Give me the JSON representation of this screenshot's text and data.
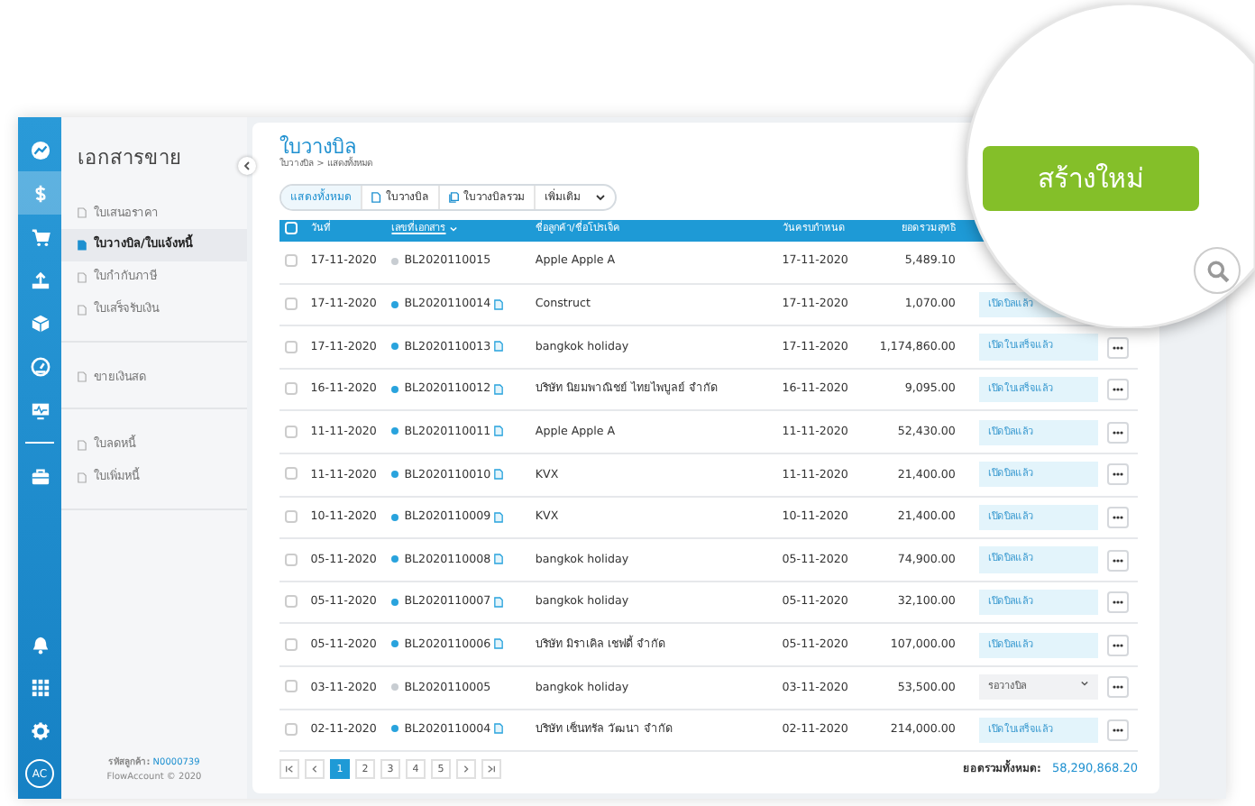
{
  "rail": {
    "top": [
      {
        "kind": "logo",
        "selected": false
      },
      {
        "kind": "dollar",
        "selected": true
      },
      {
        "kind": "cart",
        "selected": false
      },
      {
        "kind": "upload",
        "selected": false
      },
      {
        "kind": "box",
        "selected": false
      },
      {
        "kind": "gauge",
        "selected": false
      },
      {
        "kind": "monitor",
        "selected": false
      }
    ],
    "tools": [
      {
        "kind": "briefcase",
        "selected": false
      }
    ],
    "bottom": [
      {
        "kind": "bell",
        "selected": false
      },
      {
        "kind": "grid",
        "selected": false
      },
      {
        "kind": "gear",
        "selected": false
      }
    ],
    "avatar": "AC"
  },
  "sidebar": {
    "title": "เอกสารขาย",
    "groups": [
      [
        {
          "label": "ใบเสนอราคา",
          "selected": false
        },
        {
          "label": "ใบวางบิล/ใบแจ้งหนี้",
          "selected": true
        },
        {
          "label": "ใบกำกับภาษี",
          "selected": false
        },
        {
          "label": "ใบเสร็จรับเงิน",
          "selected": false
        }
      ],
      [
        {
          "label": "ขายเงินสด",
          "selected": false
        }
      ],
      [
        {
          "label": "ใบลดหนี้",
          "selected": false
        },
        {
          "label": "ใบเพิ่มหนี้",
          "selected": false
        }
      ]
    ],
    "footer": {
      "label": "รหัสลูกค้า:",
      "code": "N0000739",
      "copyright": "FlowAccount © 2020"
    }
  },
  "page": {
    "title": "ใบวางบิล",
    "breadcrumb": "ใบวางบิล > แสดงทั้งหมด",
    "filters": [
      {
        "label": "แสดงทั้งหมด",
        "selected": true
      },
      {
        "label": "ใบวางบิล",
        "selected": false
      },
      {
        "label": "ใบวางบิลรวม",
        "selected": false
      }
    ],
    "more": "เพิ่มเติม"
  },
  "table": {
    "all_checked": false,
    "columns": [
      "วันที่",
      "เลขที่เอกสาร",
      "ชื่อลูกค้า/ชื่อโปรเจ็ค",
      "วันครบกำหนด",
      "ยอดรวมสุทธิ"
    ],
    "rows": [
      {
        "checked": false,
        "date": "17-11-2020",
        "doc_no": "BL2020110015",
        "color": "#c8cdd2",
        "attachment": false,
        "customer": "Apple Apple A",
        "due": "17-11-2020",
        "total": "5,489.10",
        "status": null,
        "menu_button": false
      },
      {
        "checked": false,
        "date": "17-11-2020",
        "doc_no": "BL2020110014",
        "color": "#29a3dd",
        "attachment": true,
        "customer": "Construct",
        "due": "17-11-2020",
        "total": "1,070.00",
        "status": {
          "kind": "tag",
          "text": "เปิดบิลแล้ว"
        },
        "menu_button": false
      },
      {
        "checked": false,
        "date": "17-11-2020",
        "doc_no": "BL2020110013",
        "color": "#29a3dd",
        "attachment": true,
        "customer": "bangkok holiday",
        "due": "17-11-2020",
        "total": "1,174,860.00",
        "status": {
          "kind": "tag",
          "text": "เปิดใบเสร็จแล้ว"
        },
        "menu_button": true
      },
      {
        "checked": false,
        "date": "16-11-2020",
        "doc_no": "BL2020110012",
        "color": "#29a3dd",
        "attachment": true,
        "customer": "บริษัท นิยมพาณิชย์ ไทยไพบูลย์ จำกัด",
        "due": "16-11-2020",
        "total": "9,095.00",
        "status": {
          "kind": "tag",
          "text": "เปิดใบเสร็จแล้ว"
        },
        "menu_button": true
      },
      {
        "checked": false,
        "date": "11-11-2020",
        "doc_no": "BL2020110011",
        "color": "#29a3dd",
        "attachment": true,
        "customer": "Apple Apple A",
        "due": "11-11-2020",
        "total": "52,430.00",
        "status": {
          "kind": "tag",
          "text": "เปิดบิลแล้ว"
        },
        "menu_button": true
      },
      {
        "checked": false,
        "date": "11-11-2020",
        "doc_no": "BL2020110010",
        "color": "#29a3dd",
        "attachment": true,
        "customer": "KVX",
        "due": "11-11-2020",
        "total": "21,400.00",
        "status": {
          "kind": "tag",
          "text": "เปิดบิลแล้ว"
        },
        "menu_button": true
      },
      {
        "checked": false,
        "date": "10-11-2020",
        "doc_no": "BL2020110009",
        "color": "#29a3dd",
        "attachment": true,
        "customer": "KVX",
        "due": "10-11-2020",
        "total": "21,400.00",
        "status": {
          "kind": "tag",
          "text": "เปิดบิลแล้ว"
        },
        "menu_button": true
      },
      {
        "checked": false,
        "date": "05-11-2020",
        "doc_no": "BL2020110008",
        "color": "#29a3dd",
        "attachment": true,
        "customer": "bangkok holiday",
        "due": "05-11-2020",
        "total": "74,900.00",
        "status": {
          "kind": "tag",
          "text": "เปิดบิลแล้ว"
        },
        "menu_button": true
      },
      {
        "checked": false,
        "date": "05-11-2020",
        "doc_no": "BL2020110007",
        "color": "#29a3dd",
        "attachment": true,
        "customer": "bangkok holiday",
        "due": "05-11-2020",
        "total": "32,100.00",
        "status": {
          "kind": "tag",
          "text": "เปิดบิลแล้ว"
        },
        "menu_button": true
      },
      {
        "checked": false,
        "date": "05-11-2020",
        "doc_no": "BL2020110006",
        "color": "#29a3dd",
        "attachment": true,
        "customer": "บริษัท มิราเคิล เชฟดี้ จำกัด",
        "due": "05-11-2020",
        "total": "107,000.00",
        "status": {
          "kind": "tag",
          "text": "เปิดบิลแล้ว"
        },
        "menu_button": true
      },
      {
        "checked": false,
        "date": "03-11-2020",
        "doc_no": "BL2020110005",
        "color": "#c8cdd2",
        "attachment": false,
        "customer": "bangkok holiday",
        "due": "03-11-2020",
        "total": "53,500.00",
        "status": {
          "kind": "select",
          "text": "รอวางบิล"
        },
        "menu_button": true
      },
      {
        "checked": false,
        "date": "02-11-2020",
        "doc_no": "BL2020110004",
        "color": "#29a3dd",
        "attachment": true,
        "customer": "บริษัท เซ็นทรัล วัฒนา จำกัด",
        "due": "02-11-2020",
        "total": "214,000.00",
        "status": {
          "kind": "tag",
          "text": "เปิดใบเสร็จแล้ว"
        },
        "menu_button": true
      }
    ]
  },
  "pagination": {
    "pages": [
      {
        "label": "1",
        "selected": true
      },
      {
        "label": "2",
        "selected": false
      },
      {
        "label": "3",
        "selected": false
      },
      {
        "label": "4",
        "selected": false
      },
      {
        "label": "5",
        "selected": false
      }
    ]
  },
  "summary": {
    "label": "ยอดรวมทั้งหมด:",
    "value": "58,290,868.20"
  },
  "magnifier": {
    "create_button": "สร้างใหม่"
  }
}
